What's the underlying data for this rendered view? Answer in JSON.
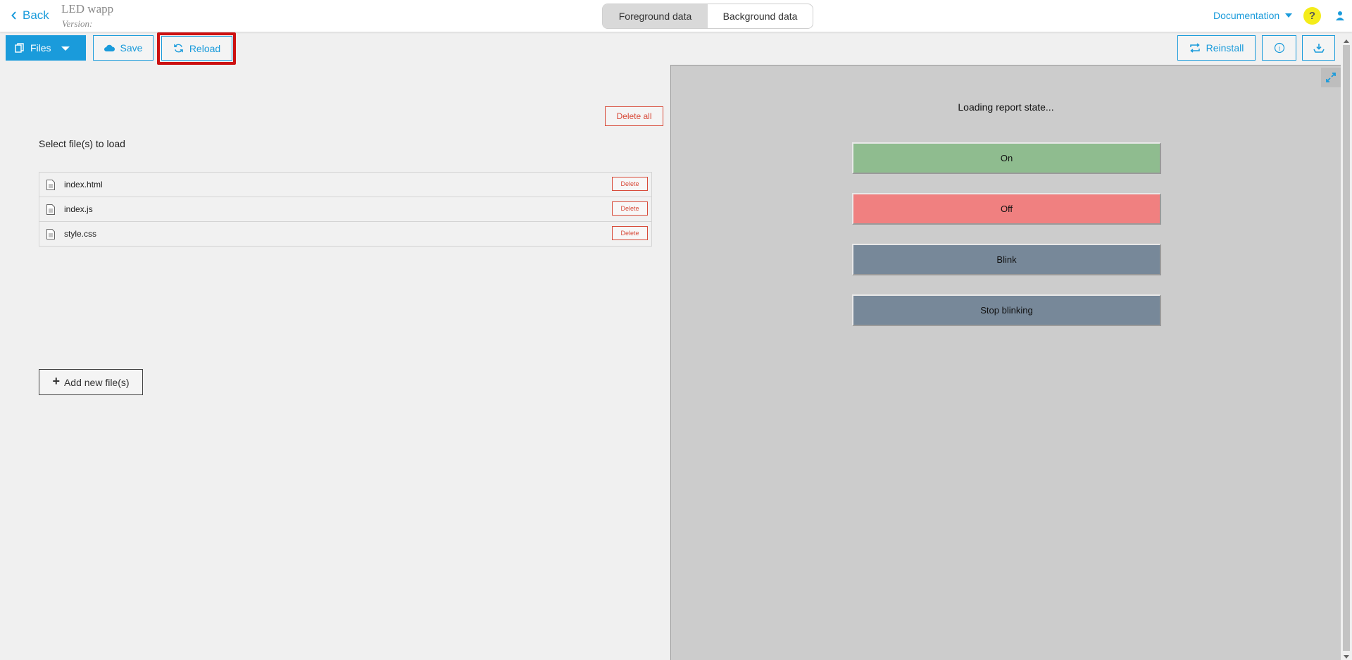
{
  "header": {
    "back_label": "Back",
    "app_title": "LED wapp",
    "version_label": "Version:",
    "tabs": [
      {
        "label": "Foreground data",
        "active": true
      },
      {
        "label": "Background data",
        "active": false
      }
    ],
    "documentation_label": "Documentation",
    "help_glyph": "?"
  },
  "toolbar": {
    "files_label": "Files",
    "save_label": "Save",
    "reload_label": "Reload",
    "reinstall_label": "Reinstall",
    "info_glyph": "i"
  },
  "files_panel": {
    "delete_all_label": "Delete all",
    "select_label": "Select file(s) to load",
    "files": [
      {
        "name": "index.html",
        "delete_label": "Delete"
      },
      {
        "name": "index.js",
        "delete_label": "Delete"
      },
      {
        "name": "style.css",
        "delete_label": "Delete"
      }
    ],
    "add_label": "Add new file(s)"
  },
  "preview": {
    "status_text": "Loading report state...",
    "buttons": [
      {
        "label": "On",
        "color": "#8fbc8f"
      },
      {
        "label": "Off",
        "color": "#f08080"
      },
      {
        "label": "Blink",
        "color": "#778899"
      },
      {
        "label": "Stop blinking",
        "color": "#778899"
      }
    ]
  },
  "colors": {
    "accent": "#1a9bdb",
    "danger": "#d84b3a",
    "highlight": "#cc1111",
    "help_badge": "#f4ec1a"
  }
}
